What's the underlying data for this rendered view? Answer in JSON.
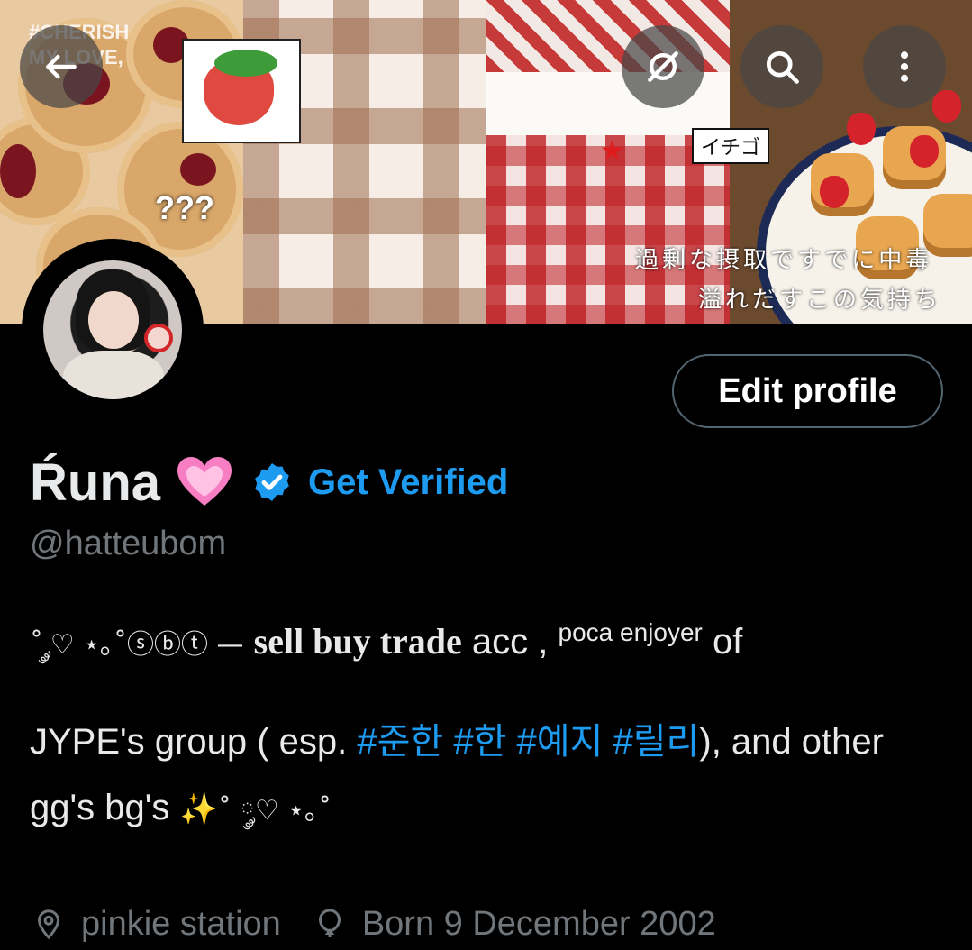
{
  "banner": {
    "sticker_text": "???",
    "overlay_text": "#CHERISH\nMY LOVE,",
    "ichigo_label": "イチゴ",
    "jp_line_1": "過剰な摂取ですでに中毒",
    "jp_line_2": "溢れだすこの気持ち"
  },
  "icons": {
    "back": "arrow-left-icon",
    "grok": "grok-icon",
    "search": "search-icon",
    "more": "more-vertical-icon",
    "location": "location-pin-icon",
    "birthday": "balloon-icon",
    "verified": "verified-badge-icon"
  },
  "profile": {
    "edit_label": "Edit profile",
    "display_name": "Ŕuna",
    "name_emoji": "💗",
    "get_verified": "Get Verified",
    "handle": "@hatteubom"
  },
  "bio": {
    "line1_symbols": "˚ ༘♡ ⋆｡˚ⓢⓑⓣ —",
    "line1_bold": "sell buy trade",
    "line1_rest": "acc ,",
    "line1_small": "poca enjoyer",
    "line1_end": "of",
    "line2_start": "JYPE's group ( esp.",
    "hashtags": [
      "#준한",
      "#한",
      "#예지",
      "#릴리"
    ],
    "line2_end": "), and other",
    "line3_text": "gg's bg's",
    "line3_emoji": "✨",
    "line3_symbols": "˚ ༘♡ ⋆｡˚"
  },
  "meta": {
    "location": "pinkie station",
    "birthday": "Born 9 December 2002"
  },
  "colors": {
    "background": "#000000",
    "accent": "#1d9bf0",
    "muted": "#71767b",
    "text": "#e7e9ea"
  }
}
